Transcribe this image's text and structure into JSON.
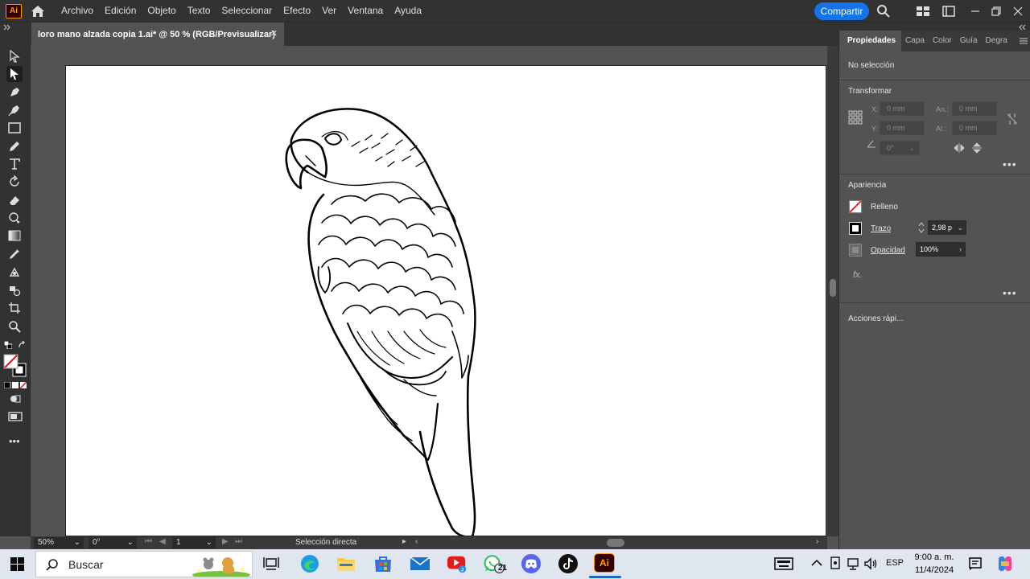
{
  "app": {
    "logo_text": "Ai"
  },
  "menu": [
    "Archivo",
    "Edición",
    "Objeto",
    "Texto",
    "Seleccionar",
    "Efecto",
    "Ver",
    "Ventana",
    "Ayuda"
  ],
  "header": {
    "share_label": "Compartir"
  },
  "document": {
    "tab_title": "loro mano alzada copia 1.ai* @ 50 % (RGB/Previsualizar)",
    "close_glyph": "✕"
  },
  "statusbar": {
    "zoom": "50%",
    "rotation": "0°",
    "artboard": "1",
    "tool_name": "Selección directa"
  },
  "panel": {
    "tabs": [
      "Propiedades",
      "Capa",
      "Color",
      "Guía",
      "Degra"
    ],
    "selection_status": "No selección",
    "transform": {
      "title": "Transformar",
      "x_label": "X:",
      "x_value": "0 mm",
      "y_label": "Y:",
      "y_value": "0 mm",
      "w_label": "An.:",
      "w_value": "0 mm",
      "h_label": "Al.:",
      "h_value": "0 mm",
      "angle_value": "0°"
    },
    "appearance": {
      "title": "Apariencia",
      "fill_label": "Relleno",
      "stroke_label": "Trazo",
      "stroke_value": "2,98 p",
      "opacity_label": "Opacidad",
      "opacity_value": "100%",
      "fx_label": "fx."
    },
    "quick_actions": "Acciones rápi..."
  },
  "taskbar": {
    "search_placeholder": "Buscar",
    "whatsapp_badge": "21",
    "language": "ESP",
    "time": "9:00 a. m.",
    "date": "11/4/2024",
    "ai_label": "Ai"
  }
}
